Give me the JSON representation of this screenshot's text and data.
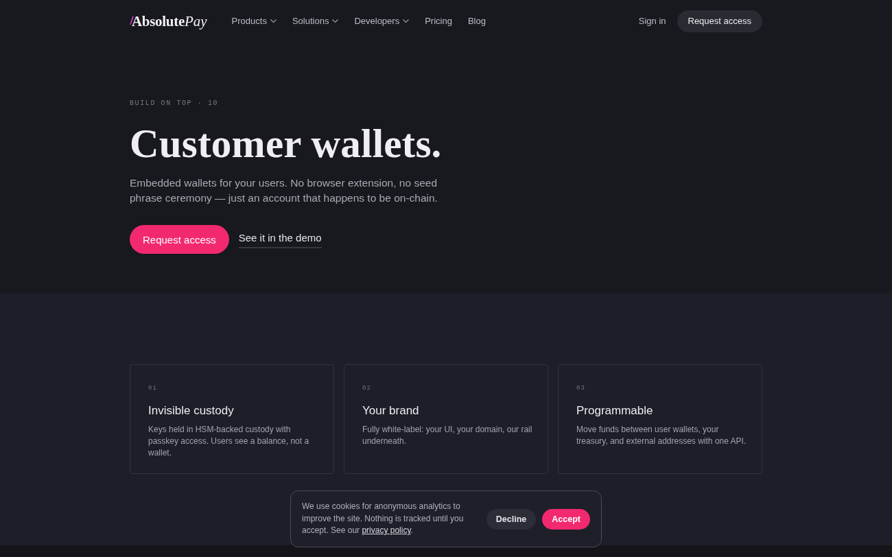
{
  "header": {
    "logo": {
      "text": "Absolute",
      "italic_text": "Pay"
    },
    "nav": [
      {
        "label": "Products",
        "has_menu": true
      },
      {
        "label": "Solutions",
        "has_menu": true
      },
      {
        "label": "Developers",
        "has_menu": true
      },
      {
        "label": "Pricing",
        "has_menu": false
      },
      {
        "label": "Blog",
        "has_menu": false
      }
    ],
    "sign_in": "Sign in",
    "cta": "Request access"
  },
  "hero": {
    "eyebrow": "BUILD ON TOP · 10",
    "title": "Customer wallets.",
    "subtitle": "Embedded wallets for your users. No browser extension, no seed phrase ceremony — just an account that happens to be on-chain.",
    "primary_button": "Request access",
    "secondary_link": "See it in the demo"
  },
  "features": [
    {
      "number": "01",
      "title": "Invisible custody",
      "description": "Keys held in HSM-backed custody with passkey access. Users see a balance, not a wallet."
    },
    {
      "number": "02",
      "title": "Your brand",
      "description": "Fully white-label: your UI, your domain, our rail underneath."
    },
    {
      "number": "03",
      "title": "Programmable",
      "description": "Move funds between user wallets, your treasury, and external addresses with one API."
    }
  ],
  "cookie_banner": {
    "text": "We use cookies for anonymous analytics to improve the site. Nothing is tracked until you accept. See our",
    "link": "privacy policy",
    "text_end": ".",
    "buttons": [
      {
        "label": "Decline",
        "kind": "secondary"
      },
      {
        "label": "Accept",
        "kind": "primary"
      }
    ]
  }
}
